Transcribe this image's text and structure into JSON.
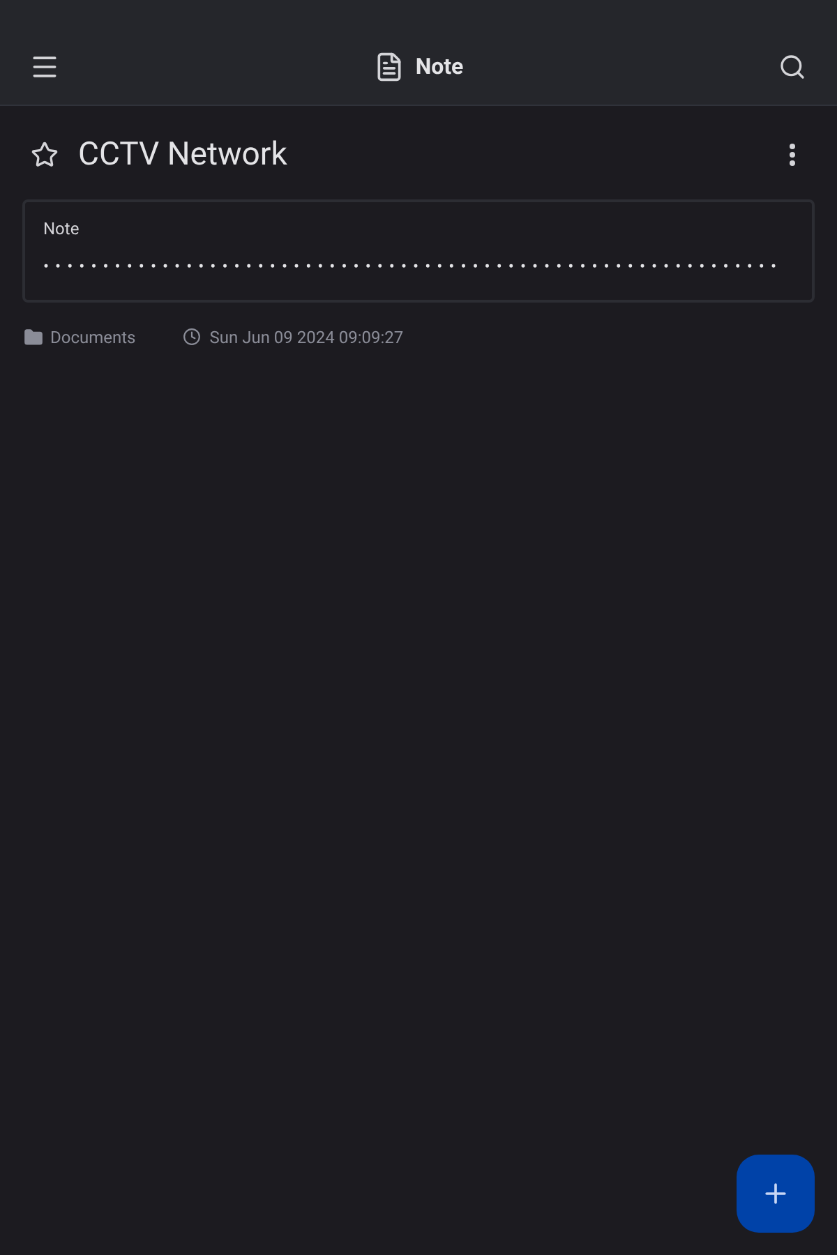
{
  "app_bar": {
    "title": "Note"
  },
  "note": {
    "title": "CCTV Network",
    "starred": false,
    "field": {
      "label": "Note",
      "value": "••••••••••••••••••••••••••••••••••••••••••••••••••••••••••••••"
    }
  },
  "meta": {
    "folder": "Documents",
    "modified": "Sun Jun 09 2024 09:09:27"
  }
}
